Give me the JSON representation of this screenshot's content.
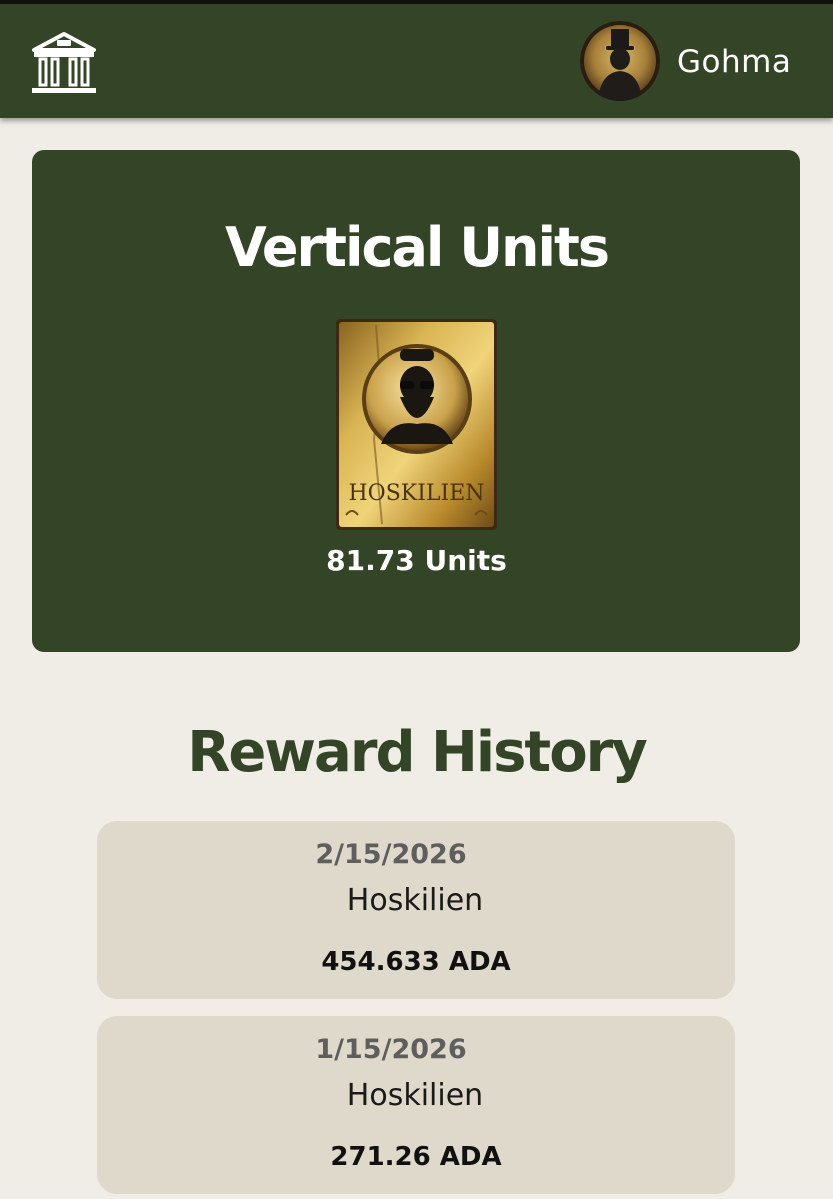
{
  "header": {
    "logo_icon": "bank-building-icon",
    "avatar_icon": "top-hat-silhouette-avatar",
    "username": "Gohma"
  },
  "units_card": {
    "title": "Vertical Units",
    "token_icon": "hoskilien-token-art",
    "token_label": "HOSKILIEN",
    "amount": "81.73 Units"
  },
  "reward_history": {
    "title": "Reward History",
    "items": [
      {
        "date": "2/15/2026",
        "name": "Hoskilien",
        "amount": "454.633 ADA"
      },
      {
        "date": "1/15/2026",
        "name": "Hoskilien",
        "amount": "271.26 ADA"
      }
    ]
  },
  "colors": {
    "brand_green": "#344426",
    "background": "#f0ede7",
    "card_beige": "#dfd9cb",
    "gold": "#c9a43a"
  }
}
